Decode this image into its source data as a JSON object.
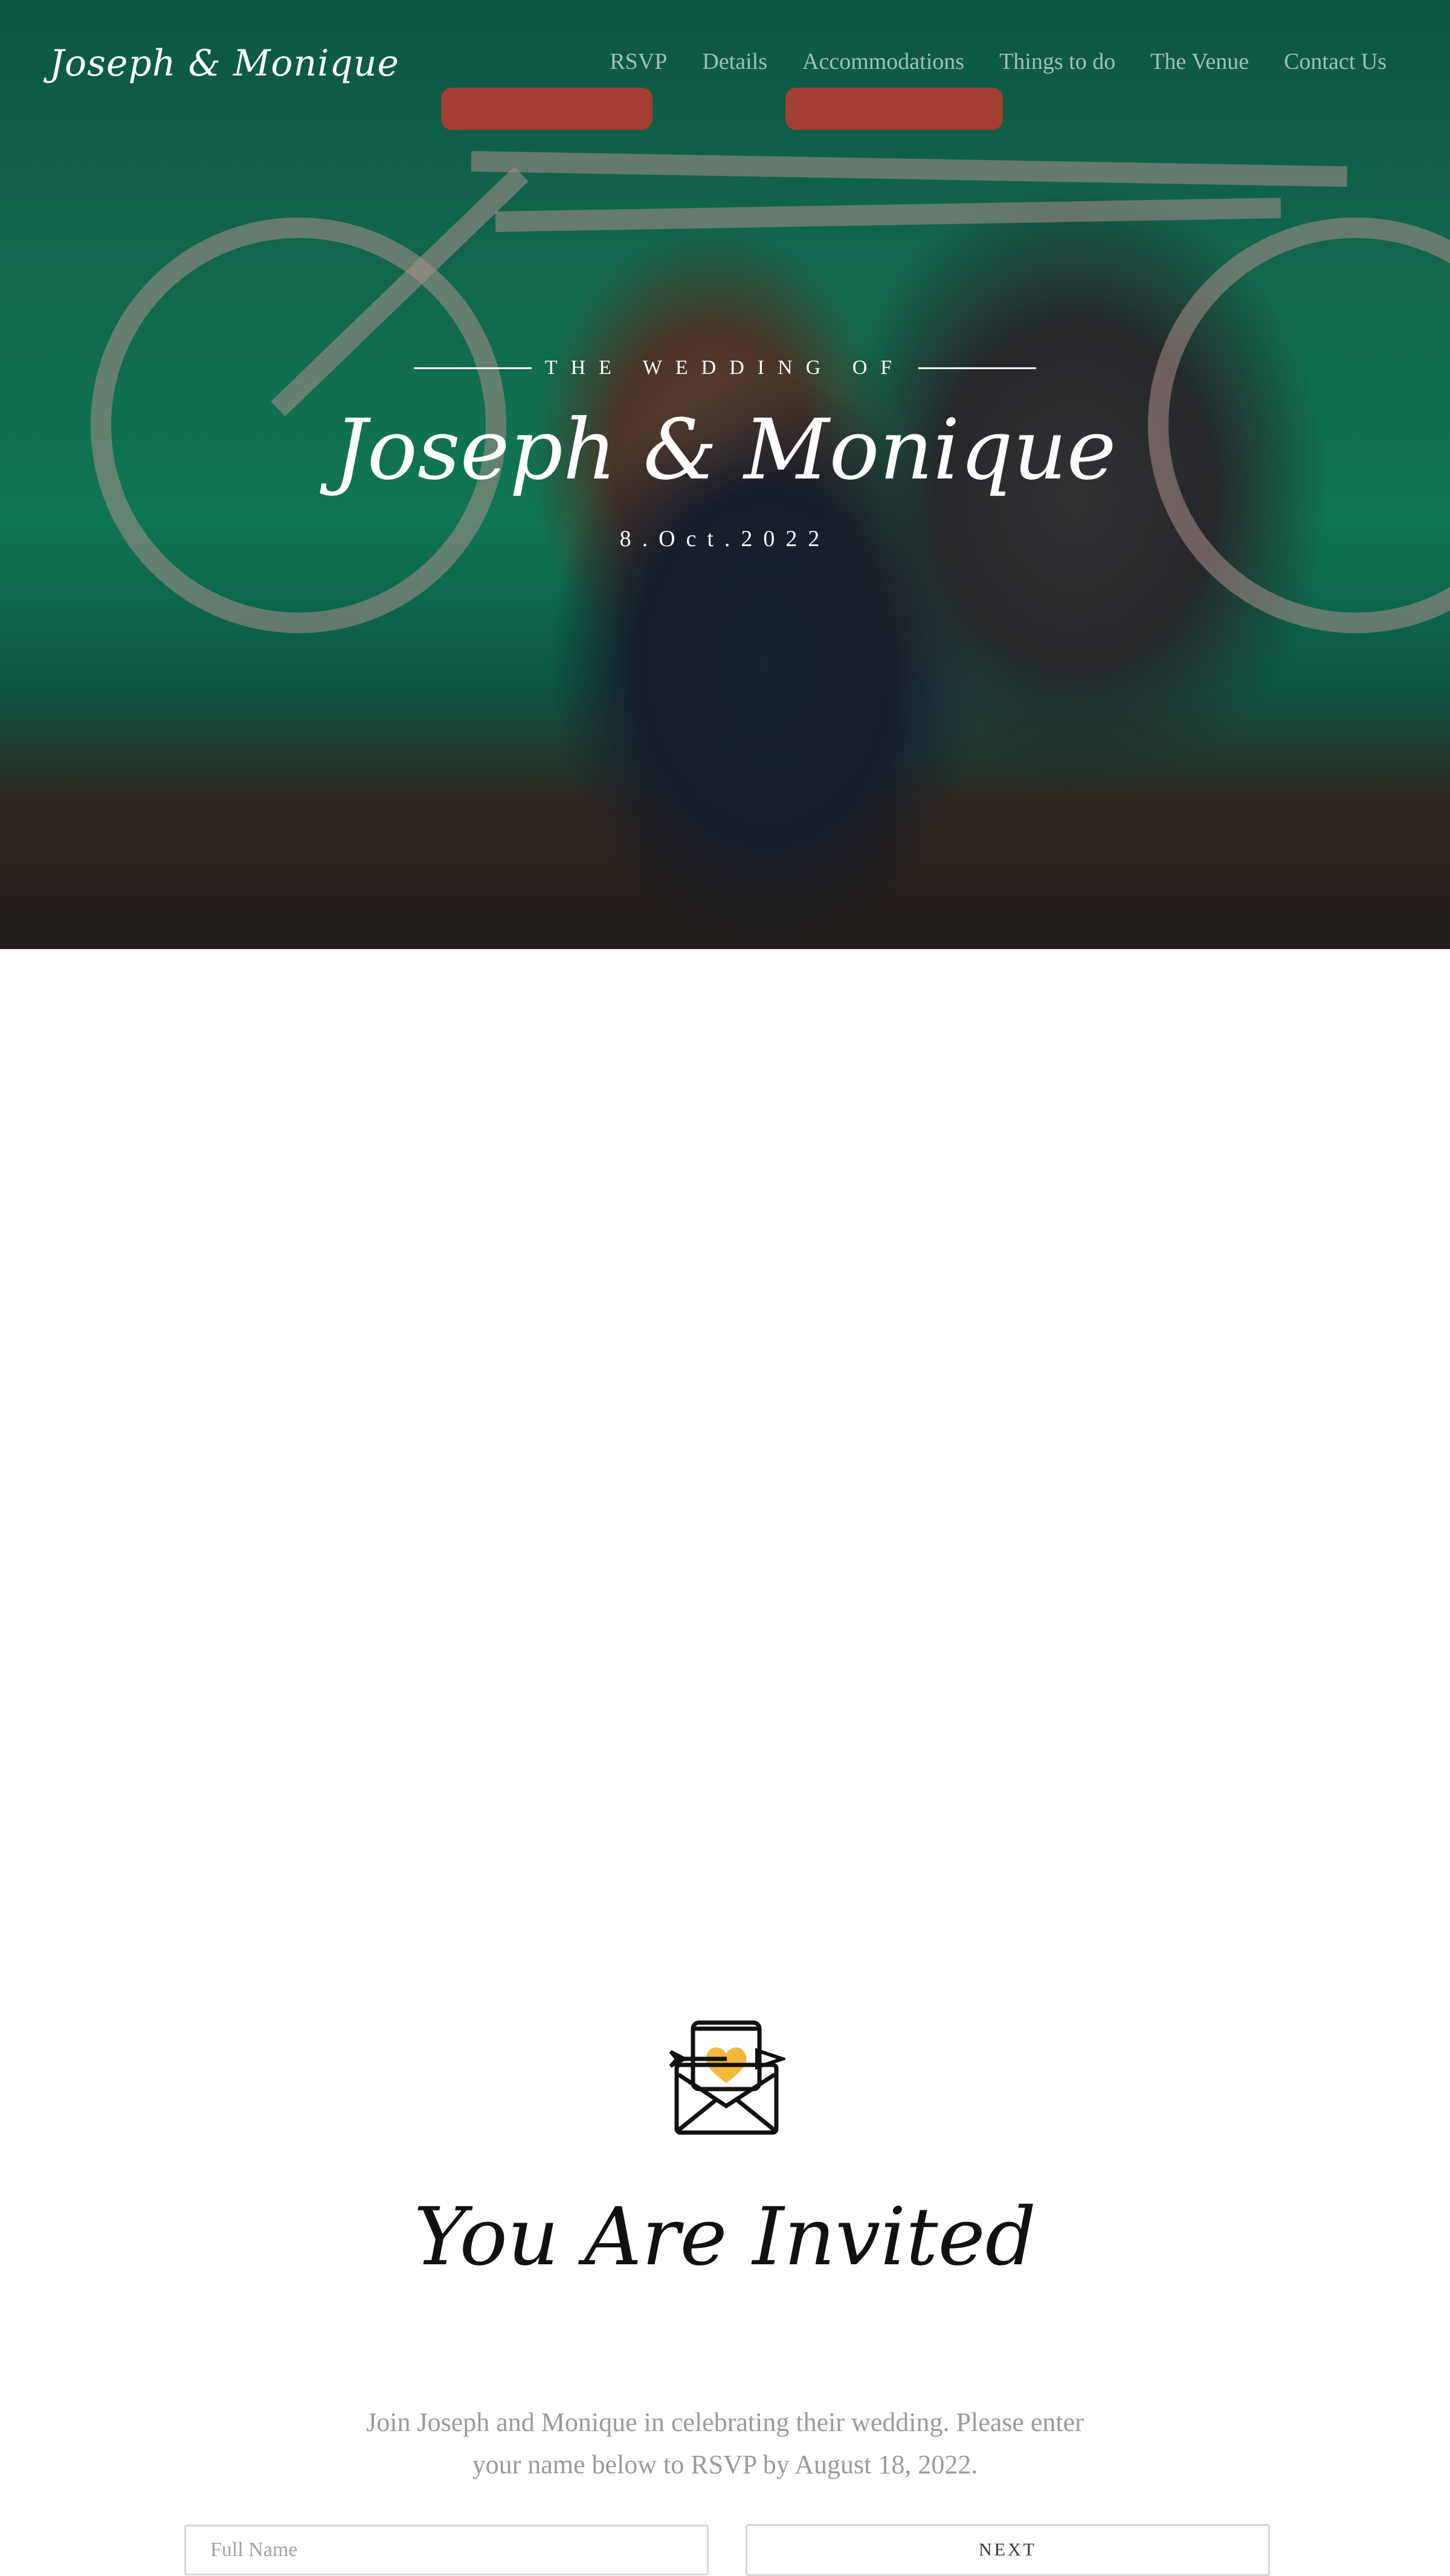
{
  "header": {
    "brand": "Joseph & Monique",
    "nav": [
      "RSVP",
      "Details",
      "Accommodations",
      "Things to do",
      "The Venue",
      "Contact Us"
    ]
  },
  "hero": {
    "kicker": "THE WEDDING OF",
    "names": "Joseph & Monique",
    "date": "8.Oct.2022"
  },
  "invite": {
    "icon": "love-letter-icon",
    "title": "You Are Invited",
    "description": "Join Joseph and Monique in celebrating their wedding. Please enter your name below to RSVP by August 18, 2022.",
    "name_placeholder": "Full Name",
    "name_value": "",
    "next_label": "NEXT"
  },
  "colors": {
    "hero_green": "#139066",
    "heart": "#f5b83c",
    "text_dark": "#111111",
    "text_muted": "#9a9a9a"
  }
}
